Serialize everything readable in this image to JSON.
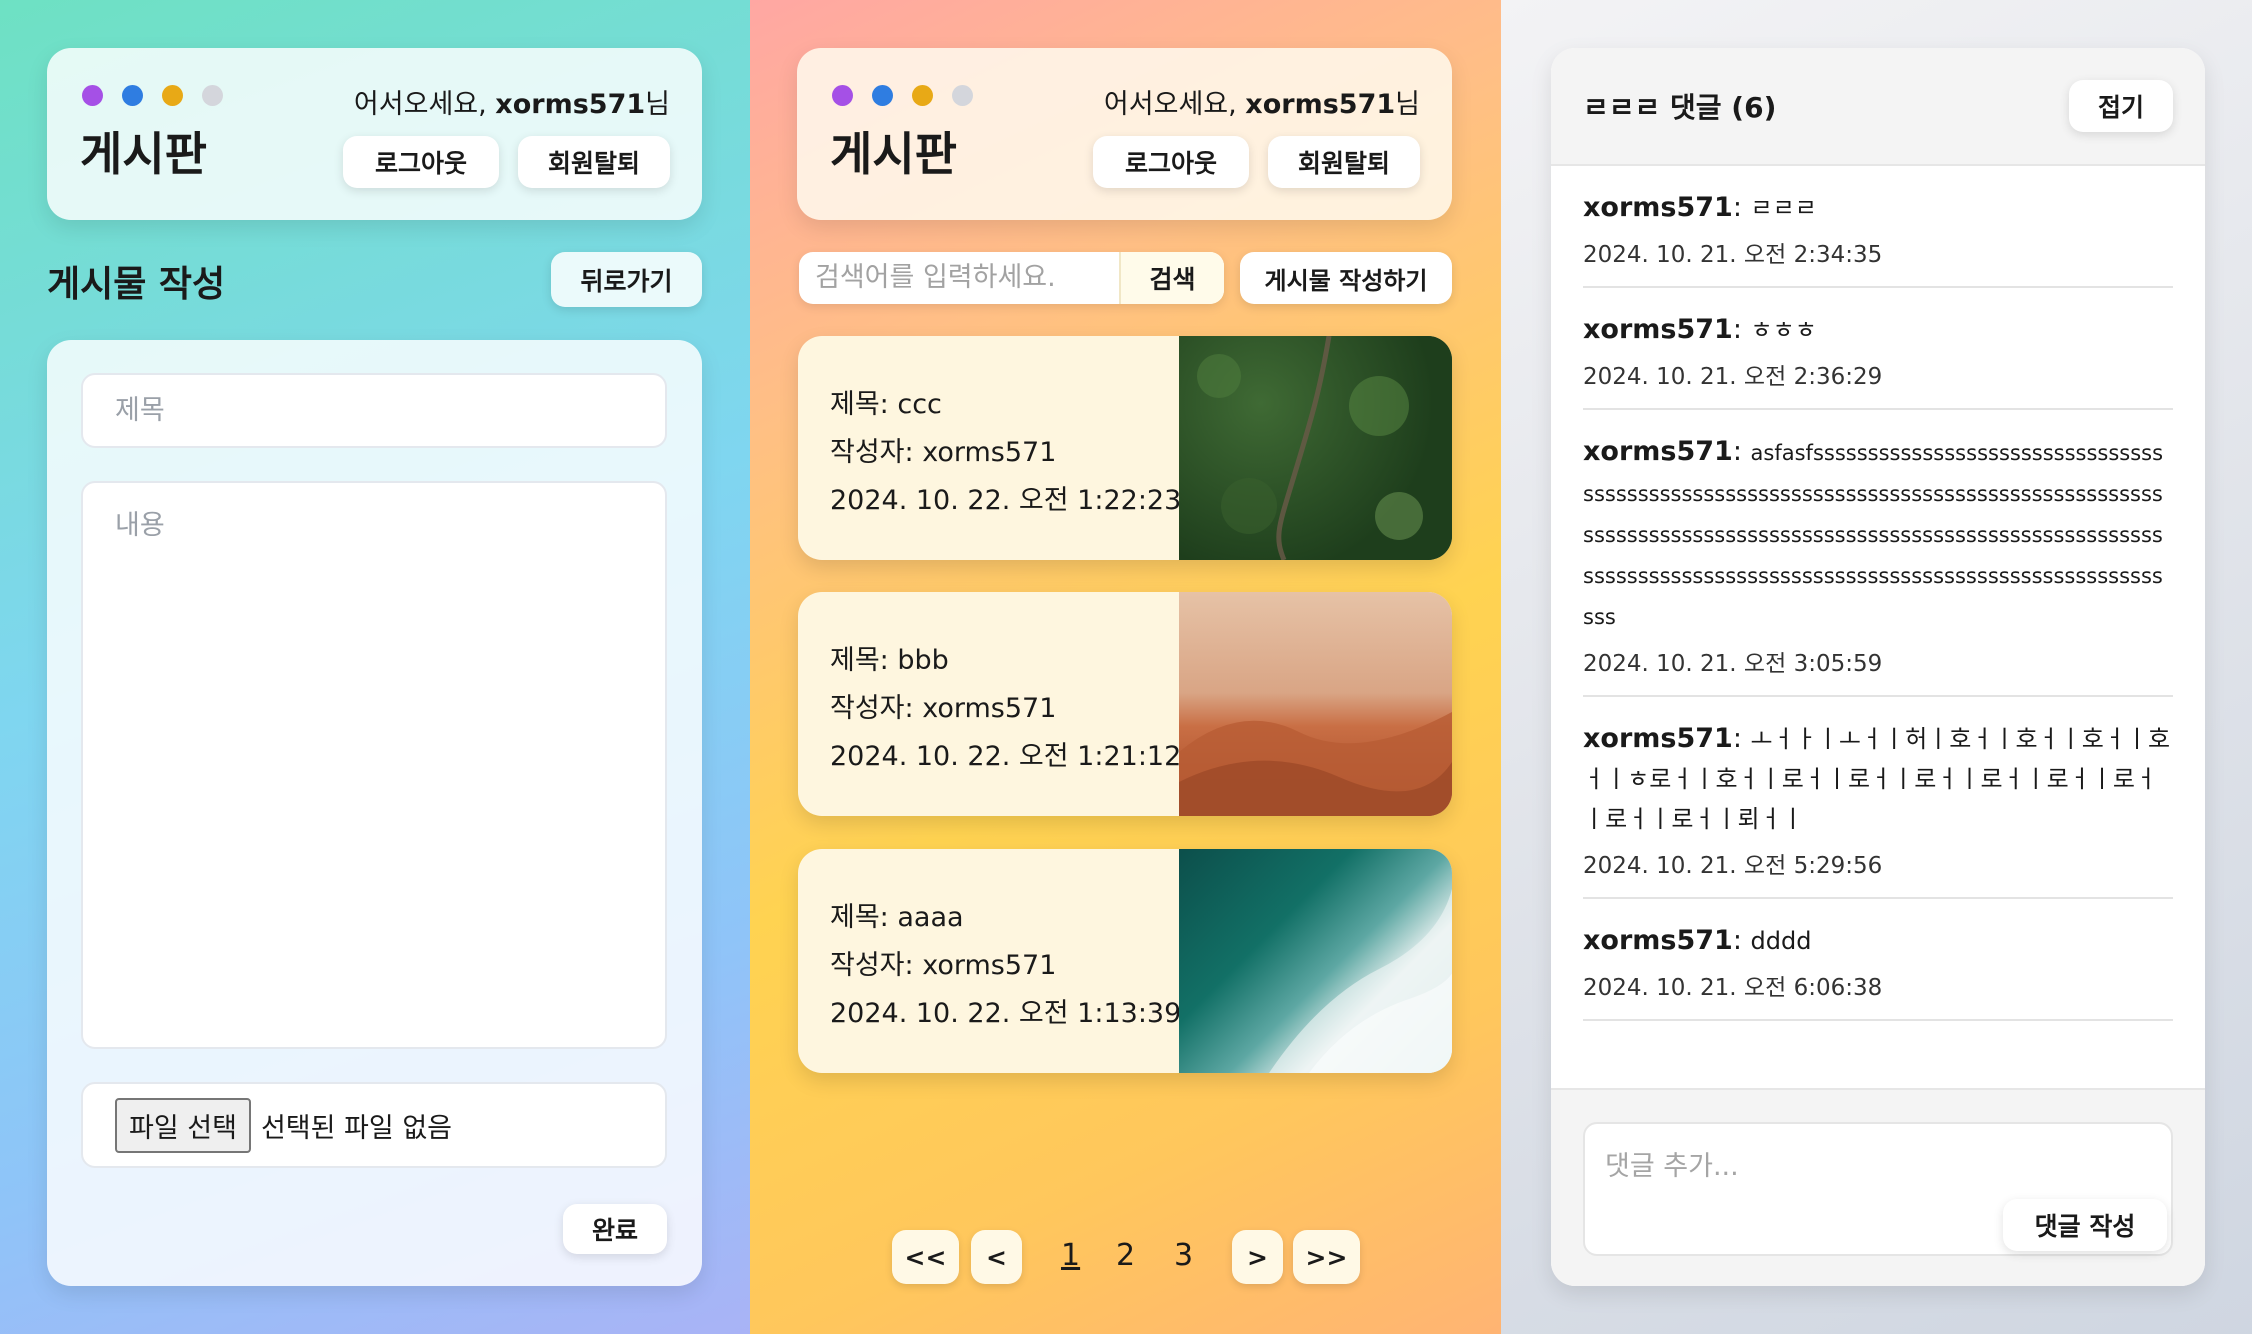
{
  "common": {
    "board_title": "게시판",
    "welcome_prefix": "어서오세요, ",
    "username": "xorms571",
    "welcome_suffix": "님",
    "logout_label": "로그아웃",
    "withdraw_label": "회원탈퇴",
    "dot_colors": [
      "#a550e6",
      "#2f7de1",
      "#e8a916",
      "#d4d6dc"
    ]
  },
  "write_panel": {
    "heading": "게시물 작성",
    "back_label": "뒤로가기",
    "title_placeholder": "제목",
    "content_placeholder": "내용",
    "file_button_label": "파일 선택",
    "file_status": "선택된 파일 없음",
    "done_label": "완료"
  },
  "list_panel": {
    "search_placeholder": "검색어를 입력하세요.",
    "search_label": "검색",
    "write_post_label": "게시물 작성하기",
    "title_prefix": "제목: ",
    "author_prefix": "작성자: ",
    "posts": [
      {
        "title": "ccc",
        "author": "xorms571",
        "date": "2024. 10. 22. 오전 1:22:23",
        "thumb": "forest"
      },
      {
        "title": "bbb",
        "author": "xorms571",
        "date": "2024. 10. 22. 오전 1:21:12",
        "thumb": "desert"
      },
      {
        "title": "aaaa",
        "author": "xorms571",
        "date": "2024. 10. 22. 오전 1:13:39",
        "thumb": "sea"
      }
    ],
    "pagination": {
      "first": "<<",
      "prev": "<",
      "pages": [
        "1",
        "2",
        "3"
      ],
      "current": "1",
      "next": ">",
      "last": ">>"
    }
  },
  "comment_panel": {
    "title": "ㄹㄹㄹ 댓글 (6)",
    "fold_label": "접기",
    "comments": [
      {
        "user": "xorms571",
        "text": "ㄹㄹㄹ",
        "date": "2024. 10. 21. 오전 2:34:35"
      },
      {
        "user": "xorms571",
        "text": "ㅎㅎㅎ",
        "date": "2024. 10. 21. 오전 2:36:29"
      },
      {
        "user": "xorms571",
        "text": "asfasfssssssssssssssssssssssssssssssssssssssssssssssssssssssssssssssssssssssssssssssssssssssssssssssssssssssssssssssssssssssssssssssssssssssssssssssssssssssssssssssssssssssssssssssssssssssssssssssssss",
        "date": "2024. 10. 21. 오전 3:05:59"
      },
      {
        "user": "xorms571",
        "text": "ㅗㅓㅏㅣㅗㅓㅣ허ㅣ호ㅓㅣ호ㅓㅣ호ㅓㅣ호ㅓㅣㅎ로ㅓㅣ호ㅓㅣ로ㅓㅣ로ㅓㅣ로ㅓㅣ로ㅓㅣ로ㅓㅣ로ㅓㅣ로ㅓㅣ로ㅓㅣ뢰ㅓㅣ",
        "date": "2024. 10. 21. 오전 5:29:56"
      },
      {
        "user": "xorms571",
        "text": "dddd",
        "date": "2024. 10. 21. 오전 6:06:38"
      }
    ],
    "comment_placeholder": "댓글 추가...",
    "submit_label": "댓글 작성"
  }
}
